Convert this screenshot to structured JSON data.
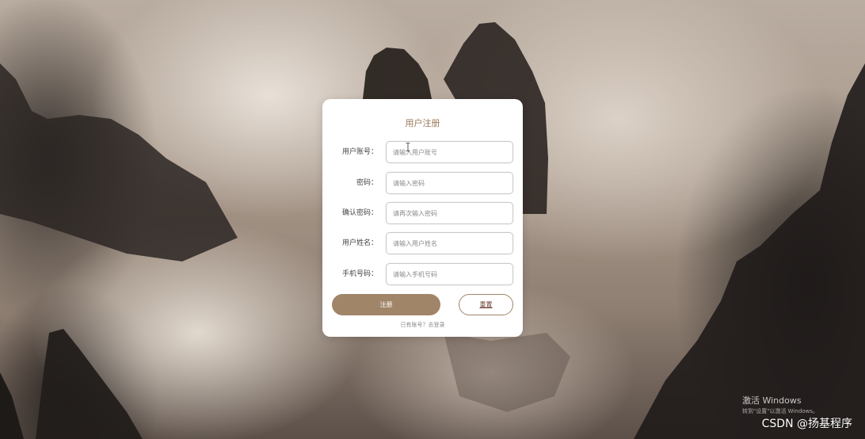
{
  "form": {
    "title": "用户注册",
    "fields": [
      {
        "label": "用户账号：",
        "placeholder": "请输入用户账号"
      },
      {
        "label": "密码：",
        "placeholder": "请输入密码"
      },
      {
        "label": "确认密码：",
        "placeholder": "请再次输入密码"
      },
      {
        "label": "用户姓名：",
        "placeholder": "请输入用户姓名"
      },
      {
        "label": "手机号码：",
        "placeholder": "请输入手机号码"
      }
    ],
    "register_label": "注册",
    "reset_label": "重置",
    "login_link": "已有账号？去登录"
  },
  "colors": {
    "accent": "#a08568",
    "title": "#9a7758",
    "reset_text": "#6b3a2a"
  },
  "watermark": {
    "windows_activate": "激活 Windows",
    "windows_hint": "转到\"设置\"以激活 Windows。",
    "csdn": "CSDN @扬基程序"
  }
}
